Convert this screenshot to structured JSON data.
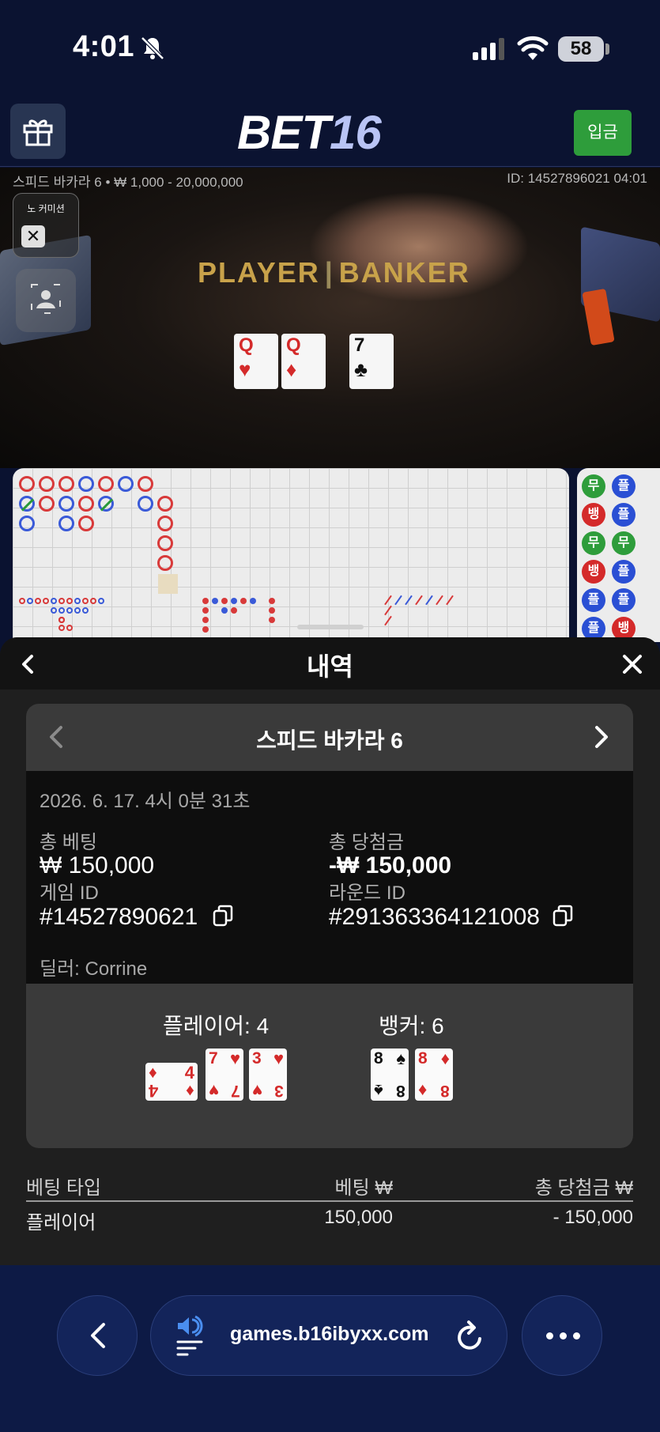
{
  "status": {
    "time": "4:01",
    "battery": "58"
  },
  "header": {
    "logo_main": "BET",
    "logo_num": "16",
    "deposit_label": "입금"
  },
  "video": {
    "table_info": "스피드 바카라 6 • ₩ 1,000 - 20,000,000",
    "id_info": "ID: 14527896021 04:01",
    "no_commission": "노 커미션",
    "table_player": "PLAYER",
    "table_banker": "BANKER",
    "cards": [
      {
        "rank": "Q",
        "suit": "♥",
        "color": "red"
      },
      {
        "rank": "Q",
        "suit": "♦",
        "color": "red"
      },
      {
        "rank": "7",
        "suit": "♣",
        "color": "black"
      }
    ]
  },
  "bead_road": [
    "무",
    "뱅",
    "무",
    "뱅",
    "플",
    "플",
    "플",
    "플",
    "무",
    "플",
    "플",
    "뱅"
  ],
  "history": {
    "title": "내역",
    "game_name": "스피드 바카라 6",
    "datetime": "2026. 6. 17. 4시 0분 31초",
    "total_bet_label": "총 베팅",
    "total_bet_value": "₩ 150,000",
    "total_win_label": "총 당첨금",
    "total_win_value": "-₩ 150,000",
    "game_id_label": "게임 ID",
    "game_id_value": "#14527890621",
    "round_id_label": "라운드 ID",
    "round_id_value": "#29136336412100​8",
    "dealer": "딜러: Corrine",
    "player_label": "플레이어: 4",
    "banker_label": "뱅커: 6",
    "player_cards": [
      {
        "rank": "4",
        "suit": "♦",
        "color": "red",
        "rotated": true
      },
      {
        "rank": "7",
        "suit": "♥",
        "color": "red"
      },
      {
        "rank": "3",
        "suit": "♥",
        "color": "red"
      }
    ],
    "banker_cards": [
      {
        "rank": "8",
        "suit": "♠",
        "color": "black"
      },
      {
        "rank": "8",
        "suit": "♦",
        "color": "red"
      }
    ],
    "table_headers": {
      "type": "베팅 타입",
      "bet": "베팅 ₩",
      "win": "총 당첨금 ₩"
    },
    "rows": [
      {
        "type": "플레이어",
        "bet": "150,000",
        "win": "- 150,000"
      }
    ]
  },
  "browser": {
    "url": "games.b16ibyxx.com"
  }
}
